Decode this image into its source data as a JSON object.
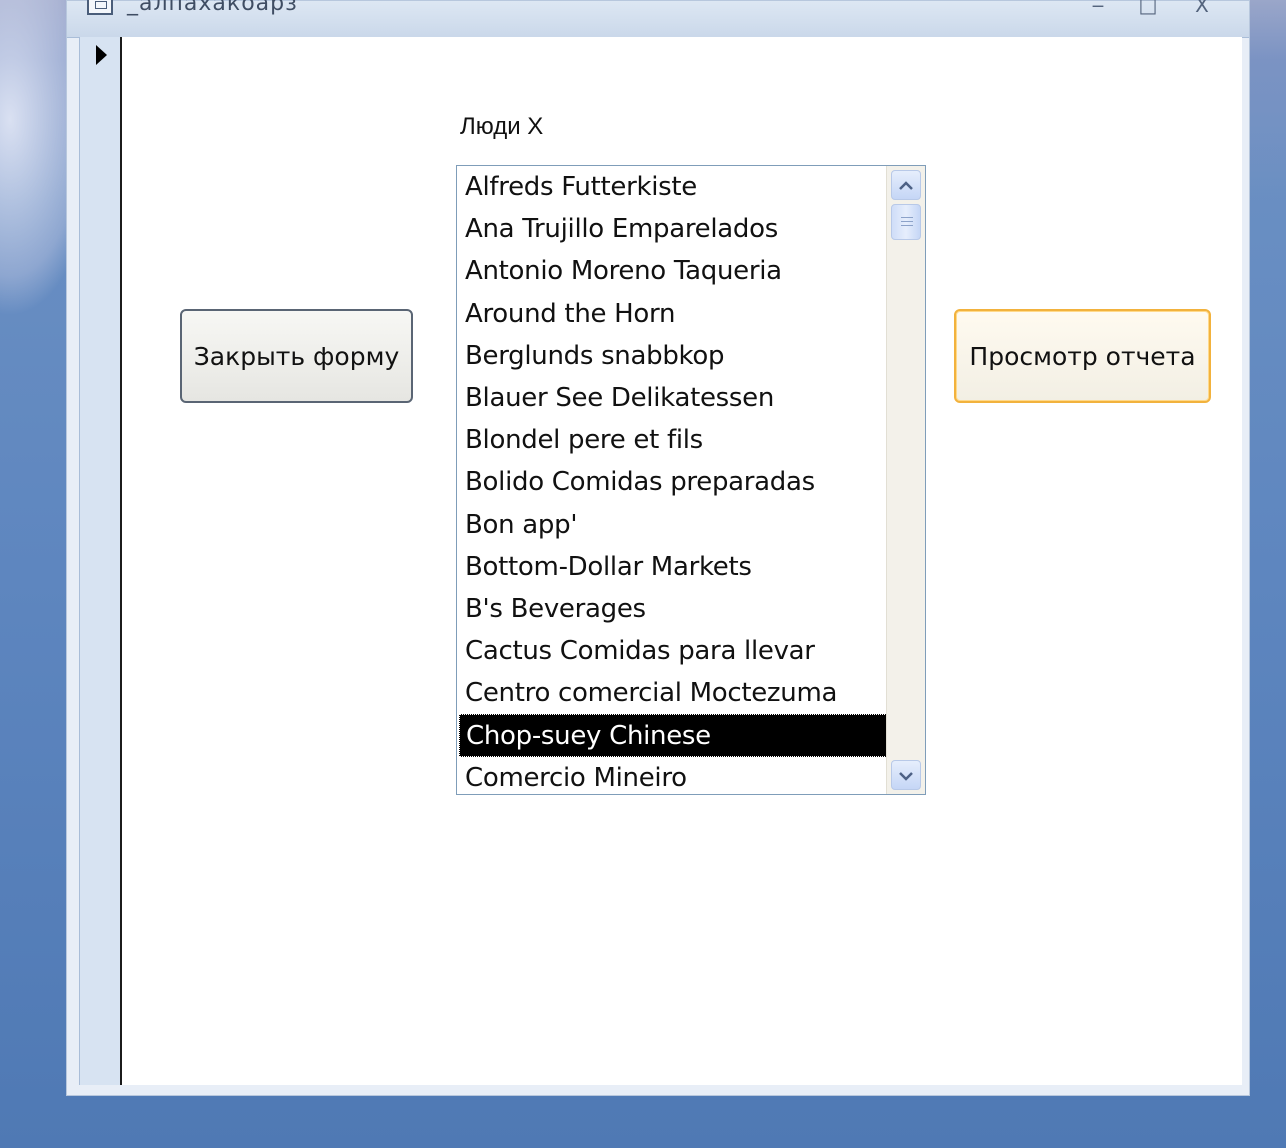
{
  "window": {
    "title": "_алпахакоарз",
    "controls": [
      "‒",
      "□",
      "X"
    ]
  },
  "form": {
    "list_label": "Люди X",
    "close_button": "Закрыть форму",
    "report_button": "Просмотр отчета",
    "list_items": [
      "Alfreds Futterkiste",
      "Ana Trujillo Emparelados",
      "Antonio Moreno Taqueria",
      "Around the Horn",
      "Berglunds snabbkop",
      "Blauer See Delikatessen",
      "Blondel pere et fils",
      "Bolido Comidas preparadas",
      "Bon app'",
      "Bottom-Dollar Markets",
      "B's Beverages",
      "Cactus Comidas para llevar",
      "Centro comercial Moctezuma",
      "Chop-suey Chinese",
      "Comercio Mineiro"
    ],
    "selected_item": "Chop-suey Chinese"
  },
  "icons": {
    "record_selector": "record-pointer-arrow-icon",
    "scroll_up": "chevron-up-icon",
    "scroll_down": "chevron-down-icon",
    "window_icon": "form-window-icon"
  },
  "colors": {
    "selection_background": "#000000",
    "selection_text": "#ffffff",
    "default_button_border": "#f2b23d",
    "desktop_background": "#5e86bf"
  }
}
